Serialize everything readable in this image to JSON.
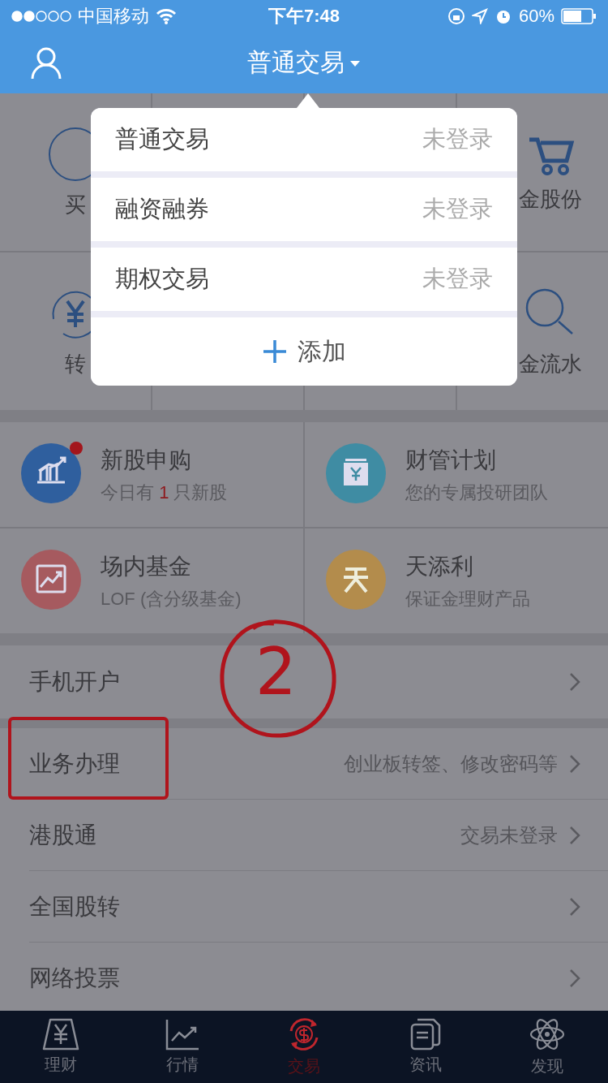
{
  "status_bar": {
    "carrier": "中国移动",
    "time": "下午7:48",
    "battery": "60%"
  },
  "header": {
    "title": "普通交易"
  },
  "dropdown": {
    "items": [
      {
        "name": "普通交易",
        "status": "未登录"
      },
      {
        "name": "融资融券",
        "status": "未登录"
      },
      {
        "name": "期权交易",
        "status": "未登录"
      }
    ],
    "add": "添加"
  },
  "shortcut_rows": [
    {
      "left": {
        "kind": "buy",
        "label": "买"
      },
      "right": {
        "kind": "cart",
        "label": "金股份"
      }
    },
    {
      "left": {
        "kind": "transfer",
        "label": "转"
      },
      "right": {
        "kind": "search",
        "label": "金流水"
      }
    }
  ],
  "cards": [
    {
      "kind": "ipo",
      "title": "新股申购",
      "subtitle": "今日有 **1** 只新股",
      "color": "#2f5f9e",
      "badge": true
    },
    {
      "kind": "plan",
      "title": "财管计划",
      "subtitle": "您的专属投研团队",
      "color": "#3f8ca3",
      "badge": false
    },
    {
      "kind": "fund",
      "title": "场内基金",
      "subtitle": "LOF (含分级基金)",
      "color": "#a65a5f",
      "badge": false
    },
    {
      "kind": "tian",
      "title": "天添利",
      "subtitle": "保证金理财产品",
      "color": "#b38c4c",
      "badge": false
    }
  ],
  "menu_groups": [
    [
      {
        "label": "手机开户",
        "highlighted": false
      }
    ],
    [
      {
        "label": "业务办理",
        "detail": "创业板转签、修改密码等",
        "highlighted": true
      },
      {
        "label": "港股通",
        "detail": "交易未登录",
        "highlighted": false
      },
      {
        "label": "全国股转",
        "highlighted": false
      },
      {
        "label": "网络投票",
        "highlighted": false
      }
    ]
  ],
  "annotation": {
    "circled_number": "2"
  },
  "tabs": [
    {
      "kind": "wealth",
      "label": "理财",
      "selected": false
    },
    {
      "kind": "market",
      "label": "行情",
      "selected": false
    },
    {
      "kind": "trade",
      "label": "交易",
      "selected": true
    },
    {
      "kind": "news",
      "label": "资讯",
      "selected": false
    },
    {
      "kind": "discover",
      "label": "发现",
      "selected": false
    }
  ]
}
